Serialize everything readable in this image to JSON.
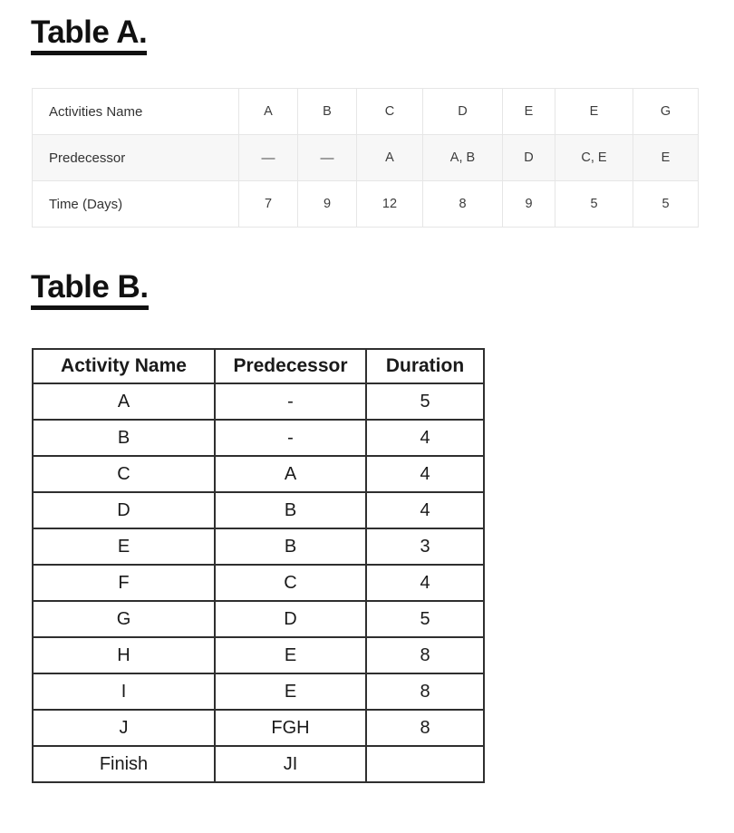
{
  "headings": {
    "table_a": "Table A.",
    "table_b": "Table B."
  },
  "table_a": {
    "row_labels": [
      "Activities Name",
      "Predecessor",
      "Time (Days)"
    ],
    "activities": [
      "A",
      "B",
      "C",
      "D",
      "E",
      "E",
      "G"
    ],
    "predecessors": [
      "—",
      "—",
      "A",
      "A, B",
      "D",
      "C, E",
      "E"
    ],
    "times": [
      "7",
      "9",
      "12",
      "8",
      "9",
      "5",
      "5"
    ]
  },
  "table_b": {
    "headers": [
      "Activity Name",
      "Predecessor",
      "Duration"
    ],
    "rows": [
      {
        "activity": "A",
        "predecessor": "-",
        "duration": "5"
      },
      {
        "activity": "B",
        "predecessor": "-",
        "duration": "4"
      },
      {
        "activity": "C",
        "predecessor": "A",
        "duration": "4"
      },
      {
        "activity": "D",
        "predecessor": "B",
        "duration": "4"
      },
      {
        "activity": "E",
        "predecessor": "B",
        "duration": "3"
      },
      {
        "activity": "F",
        "predecessor": "C",
        "duration": "4"
      },
      {
        "activity": "G",
        "predecessor": "D",
        "duration": "5"
      },
      {
        "activity": "H",
        "predecessor": "E",
        "duration": "8"
      },
      {
        "activity": "I",
        "predecessor": "E",
        "duration": "8"
      },
      {
        "activity": "J",
        "predecessor": "FGH",
        "duration": "8"
      },
      {
        "activity": "Finish",
        "predecessor": "JI",
        "duration": ""
      }
    ]
  },
  "colors": {
    "table_a_border": "#e6e6e6",
    "table_a_shaded_row": "#f7f7f7",
    "table_b_border": "#2f2f2f",
    "text": "#1a1a1a",
    "page_background": "#ffffff"
  }
}
